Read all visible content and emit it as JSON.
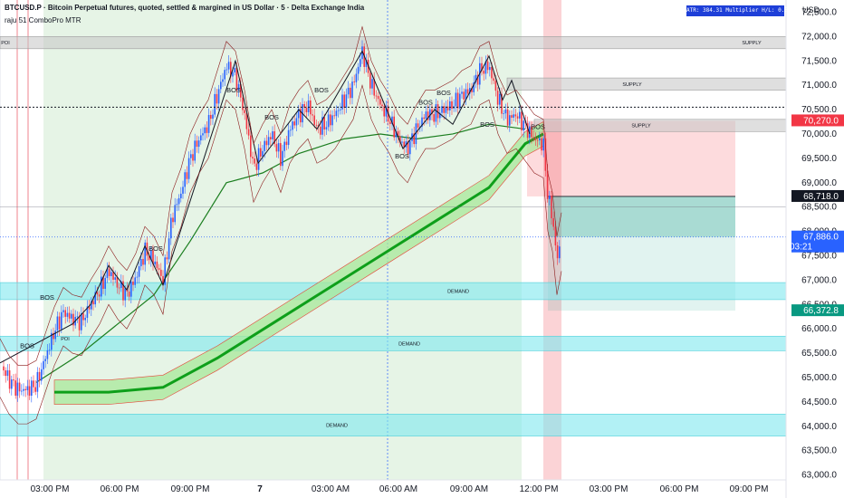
{
  "header": {
    "title": "BTCUSD.P · Bitcoin Perpetual futures, quoted, settled & margined in US Dollar · 5 · Delta Exchange India",
    "indicator": "raju 51 ComboPro MTR",
    "atr_text": "ATR: 384.31   Multiplier H/L: 0.3/0.3"
  },
  "axis": {
    "currency": "USD",
    "y_ticks": [
      "72,500.0",
      "72,000.0",
      "71,500.0",
      "71,000.0",
      "70,500.0",
      "70,000.0",
      "69,500.0",
      "69,000.0",
      "68,500.0",
      "68,000.0",
      "67,500.0",
      "67,000.0",
      "66,500.0",
      "66,000.0",
      "65,500.0",
      "65,000.0",
      "64,500.0",
      "64,000.0",
      "63,500.0",
      "63,000.0"
    ],
    "x_ticks": [
      "03:00 PM",
      "06:00 PM",
      "09:00 PM",
      "7",
      "03:00 AM",
      "06:00 AM",
      "09:00 AM",
      "12:00 PM",
      "03:00 PM",
      "06:00 PM",
      "09:00 PM"
    ]
  },
  "price_badges": [
    {
      "label": "70,270.0",
      "value": 70270,
      "bg": "#f23645",
      "fg": "#ffffff"
    },
    {
      "label": "68,718.0",
      "value": 68718,
      "bg": "#131722",
      "fg": "#ffffff"
    },
    {
      "label": "67,886.0",
      "value": 67886,
      "bg": "#2962ff",
      "fg": "#ffffff",
      "sub": "03:21"
    },
    {
      "label": "66,372.8",
      "value": 66372.8,
      "bg": "#089981",
      "fg": "#ffffff"
    }
  ],
  "zones": [
    {
      "label": "SUPPLY",
      "kind": "supply"
    },
    {
      "label": "SUPPLY",
      "kind": "supply"
    },
    {
      "label": "SUPPLY",
      "kind": "supply"
    },
    {
      "label": "DEMAND",
      "kind": "demand"
    },
    {
      "label": "DEMAND",
      "kind": "demand"
    },
    {
      "label": "DEMAND",
      "kind": "demand"
    },
    {
      "label": "POI",
      "kind": "poi"
    },
    {
      "label": "POI",
      "kind": "poi"
    }
  ],
  "structure_labels": [
    "BOS",
    "BOS",
    "BOS",
    "BOS",
    "BOS",
    "BOS",
    "BOS",
    "BOS",
    "BOS",
    "BOS",
    "BOS"
  ],
  "colors": {
    "up": "#2962ff",
    "down": "#f23645",
    "session_bg": "#e6f4e6",
    "demand": "#7ee8ef",
    "supply": "#c4c4c4",
    "ma_thick": "#0e9f1a",
    "band": "#a8e89a"
  },
  "chart_data": {
    "type": "candlestick",
    "symbol": "BTCUSD.P",
    "timeframe": "5",
    "ylim": [
      62900,
      72750
    ],
    "last_price": 67886,
    "path": [
      [
        0,
        65300
      ],
      [
        10,
        64950
      ],
      [
        20,
        64750
      ],
      [
        30,
        64750
      ],
      [
        40,
        64850
      ],
      [
        50,
        65400
      ],
      [
        60,
        65950
      ],
      [
        70,
        66350
      ],
      [
        80,
        66200
      ],
      [
        90,
        66150
      ],
      [
        100,
        66500
      ],
      [
        110,
        66800
      ],
      [
        120,
        67200
      ],
      [
        130,
        66900
      ],
      [
        140,
        66700
      ],
      [
        150,
        67050
      ],
      [
        160,
        67600
      ],
      [
        170,
        67400
      ],
      [
        180,
        67000
      ],
      [
        190,
        68300
      ],
      [
        200,
        68800
      ],
      [
        210,
        69500
      ],
      [
        220,
        69900
      ],
      [
        230,
        70200
      ],
      [
        240,
        70800
      ],
      [
        250,
        71400
      ],
      [
        260,
        71200
      ],
      [
        270,
        70400
      ],
      [
        280,
        69300
      ],
      [
        290,
        69700
      ],
      [
        300,
        70000
      ],
      [
        310,
        69500
      ],
      [
        320,
        70100
      ],
      [
        330,
        70400
      ],
      [
        340,
        70600
      ],
      [
        350,
        70100
      ],
      [
        360,
        70200
      ],
      [
        370,
        70400
      ],
      [
        380,
        70700
      ],
      [
        390,
        71000
      ],
      [
        400,
        71700
      ],
      [
        410,
        71000
      ],
      [
        420,
        70600
      ],
      [
        430,
        70300
      ],
      [
        440,
        69900
      ],
      [
        450,
        69700
      ],
      [
        460,
        70100
      ],
      [
        470,
        70400
      ],
      [
        480,
        70400
      ],
      [
        490,
        70500
      ],
      [
        500,
        70600
      ],
      [
        510,
        70800
      ],
      [
        520,
        70900
      ],
      [
        530,
        71300
      ],
      [
        540,
        71400
      ],
      [
        550,
        70700
      ],
      [
        560,
        70300
      ],
      [
        570,
        70400
      ],
      [
        580,
        70150
      ],
      [
        590,
        69900
      ],
      [
        600,
        69800
      ],
      [
        605,
        68700
      ],
      [
        610,
        68300
      ],
      [
        615,
        67400
      ],
      [
        620,
        67886
      ]
    ],
    "ma_thick": [
      [
        60,
        64700
      ],
      [
        120,
        64700
      ],
      [
        180,
        64800
      ],
      [
        240,
        65400
      ],
      [
        300,
        66100
      ],
      [
        360,
        66800
      ],
      [
        420,
        67500
      ],
      [
        480,
        68200
      ],
      [
        540,
        68900
      ],
      [
        580,
        69800
      ],
      [
        600,
        70000
      ]
    ],
    "ma_inner": [
      [
        40,
        64900
      ],
      [
        90,
        65500
      ],
      [
        130,
        66100
      ],
      [
        170,
        66700
      ],
      [
        210,
        67800
      ],
      [
        250,
        69000
      ],
      [
        290,
        69200
      ],
      [
        330,
        69600
      ],
      [
        380,
        69900
      ],
      [
        420,
        70000
      ],
      [
        460,
        69900
      ],
      [
        500,
        70000
      ],
      [
        540,
        70200
      ],
      [
        580,
        70100
      ]
    ],
    "zones": [
      {
        "label": "SUPPLY",
        "y": [
          71750,
          72000
        ],
        "x": [
          0,
          868
        ]
      },
      {
        "label": "SUPPLY",
        "y": [
          70900,
          71150
        ],
        "x": [
          560,
          868
        ]
      },
      {
        "label": "SUPPLY",
        "y": [
          70050,
          70300
        ],
        "x": [
          590,
          868
        ]
      },
      {
        "label": "DEMAND",
        "y": [
          66600,
          66950
        ],
        "x": [
          0,
          868
        ]
      },
      {
        "label": "DEMAND",
        "y": [
          65550,
          65850
        ],
        "x": [
          0,
          868
        ]
      },
      {
        "label": "DEMAND",
        "y": [
          63800,
          64250
        ],
        "x": [
          0,
          868
        ]
      }
    ],
    "position": {
      "entry": 68718,
      "stop": 70270,
      "target": 66372.8
    },
    "dotted_level": 70550
  }
}
